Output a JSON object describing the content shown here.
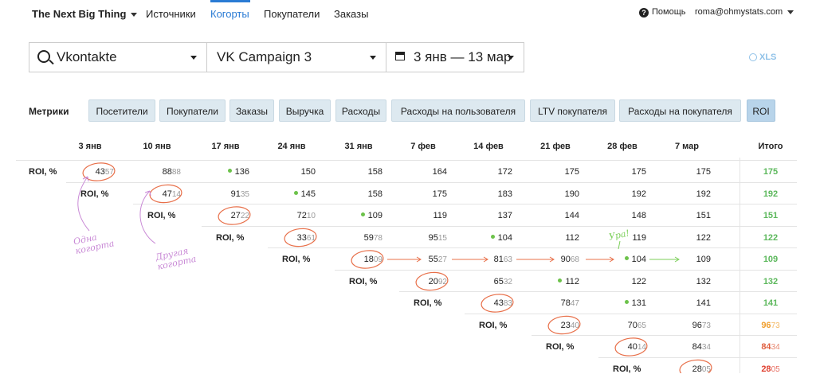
{
  "nav": {
    "brand": "The Next Big Thing",
    "links": [
      "Источники",
      "Когорты",
      "Покупатели",
      "Заказы"
    ],
    "active": "Когорты",
    "help": "Помощь",
    "user": "roma@ohmystats.com"
  },
  "filters": {
    "source": "Vkontakte",
    "campaign": "VK Campaign 3",
    "date_range": "3 янв — 13 мар",
    "export": "XLS"
  },
  "metrics": {
    "label": "Метрики",
    "buttons": [
      "Посетители",
      "Покупатели",
      "Заказы",
      "Выручка",
      "Расходы",
      "Расходы на пользователя",
      "LTV покупателя",
      "Расходы на покупателя",
      "ROI"
    ],
    "active": "ROI"
  },
  "table": {
    "headers": [
      "3 янв",
      "10 янв",
      "17 янв",
      "24 янв",
      "31 янв",
      "7 фев",
      "14 фев",
      "21 фев",
      "28 фев",
      "7 мар"
    ],
    "total_header": "Итого",
    "row_label": "ROI, %",
    "rows": [
      {
        "cells": [
          {
            "v": "43",
            "d": "57",
            "circled": true
          },
          {
            "v": "88",
            "d": "88"
          },
          {
            "v": "136",
            "dot": true
          },
          {
            "v": "150"
          },
          {
            "v": "158"
          },
          {
            "v": "164"
          },
          {
            "v": "172"
          },
          {
            "v": "175"
          },
          {
            "v": "175"
          },
          {
            "v": "175"
          }
        ],
        "total": {
          "v": "175"
        }
      },
      {
        "cells": [
          {
            "v": "47",
            "d": "14",
            "circled": true
          },
          {
            "v": "91",
            "d": "35"
          },
          {
            "v": "145",
            "dot": true
          },
          {
            "v": "158"
          },
          {
            "v": "175"
          },
          {
            "v": "183"
          },
          {
            "v": "190"
          },
          {
            "v": "192"
          },
          {
            "v": "192"
          }
        ],
        "total": {
          "v": "192"
        }
      },
      {
        "cells": [
          {
            "v": "27",
            "d": "22",
            "circled": true
          },
          {
            "v": "72",
            "d": "10"
          },
          {
            "v": "109",
            "dot": true
          },
          {
            "v": "119"
          },
          {
            "v": "137"
          },
          {
            "v": "144"
          },
          {
            "v": "148"
          },
          {
            "v": "151"
          }
        ],
        "total": {
          "v": "151"
        }
      },
      {
        "cells": [
          {
            "v": "33",
            "d": "61",
            "circled": true
          },
          {
            "v": "59",
            "d": "78"
          },
          {
            "v": "95",
            "d": "15"
          },
          {
            "v": "104",
            "dot": true
          },
          {
            "v": "112"
          },
          {
            "v": "119"
          },
          {
            "v": "122"
          }
        ],
        "total": {
          "v": "122"
        }
      },
      {
        "cells": [
          {
            "v": "18",
            "d": "09",
            "circled": true
          },
          {
            "v": "55",
            "d": "27"
          },
          {
            "v": "81",
            "d": "63"
          },
          {
            "v": "90",
            "d": "68"
          },
          {
            "v": "104",
            "dot": true
          },
          {
            "v": "109"
          }
        ],
        "total": {
          "v": "109"
        }
      },
      {
        "cells": [
          {
            "v": "20",
            "d": "92",
            "circled": true
          },
          {
            "v": "65",
            "d": "32"
          },
          {
            "v": "112",
            "dot": true
          },
          {
            "v": "122"
          },
          {
            "v": "132"
          }
        ],
        "total": {
          "v": "132"
        }
      },
      {
        "cells": [
          {
            "v": "43",
            "d": "83",
            "circled": true
          },
          {
            "v": "78",
            "d": "47"
          },
          {
            "v": "131",
            "dot": true
          },
          {
            "v": "141"
          }
        ],
        "total": {
          "v": "141"
        }
      },
      {
        "cells": [
          {
            "v": "23",
            "d": "40",
            "circled": true
          },
          {
            "v": "70",
            "d": "65"
          },
          {
            "v": "96",
            "d": "73"
          }
        ],
        "total": {
          "v": "96",
          "d": "73"
        }
      },
      {
        "cells": [
          {
            "v": "40",
            "d": "14",
            "circled": true
          },
          {
            "v": "84",
            "d": "34"
          }
        ],
        "total": {
          "v": "84",
          "d": "34"
        }
      },
      {
        "cells": [
          {
            "v": "28",
            "d": "05",
            "circled": true
          }
        ],
        "total": {
          "v": "28",
          "d": "05"
        }
      }
    ],
    "total_colors": [
      "#5cb85c",
      "#5cb85c",
      "#5cb85c",
      "#5cb85c",
      "#5cb85c",
      "#5cb85c",
      "#5cb85c",
      "#f0a030",
      "#e06040",
      "#e04030"
    ]
  },
  "annotations": {
    "cohort1": "Одна когорта",
    "cohort2": "Другая когорта",
    "hooray": "Ура!",
    "circle_color": "#e8704a",
    "note_color": "#c98ad6",
    "green_arrow": "#7ccf5a"
  }
}
